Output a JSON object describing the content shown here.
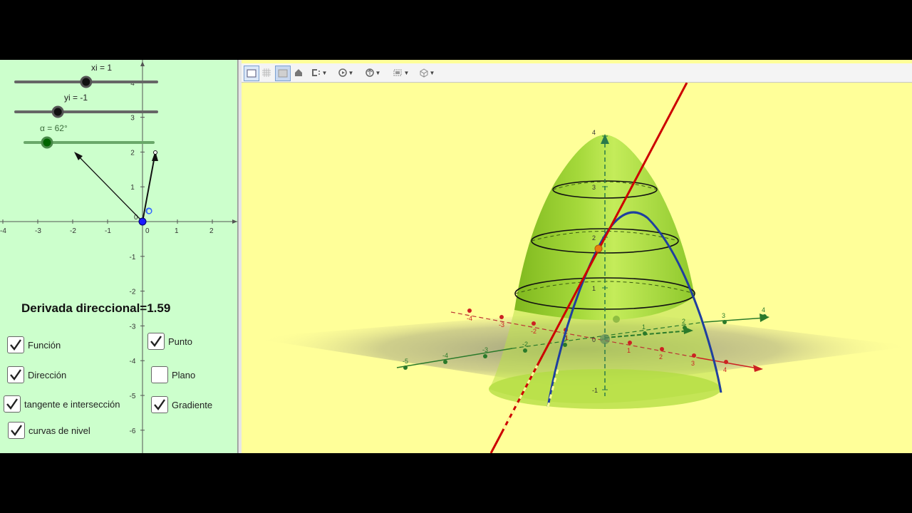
{
  "colors": {
    "left_bg": "#ccffcc",
    "right_bg": "#ffff99",
    "surface": "#9acd32",
    "red_line": "#cc0000",
    "blue_curve": "#1f3f9f"
  },
  "sliders": [
    {
      "label": "xi = 1",
      "value": 1,
      "min": -5,
      "max": 5
    },
    {
      "label": "yi = -1",
      "value": -1,
      "min": -5,
      "max": 5
    },
    {
      "label": "α = 62°",
      "value": 62,
      "min": 0,
      "max": 360
    }
  ],
  "derivative": {
    "text": "Derivada direccional=1.59"
  },
  "checkboxes": [
    {
      "label": "Función",
      "checked": true
    },
    {
      "label": "Dirección",
      "checked": true
    },
    {
      "label": "tangente e intersección",
      "checked": true
    },
    {
      "label": "curvas de nivel",
      "checked": true
    },
    {
      "label": "Punto",
      "checked": true
    },
    {
      "label": "Plano",
      "checked": false
    },
    {
      "label": "Gradiente",
      "checked": true
    }
  ],
  "graphics2d": {
    "x_ticks": [
      "-4",
      "-3",
      "-2",
      "-1",
      "0",
      "1",
      "2"
    ],
    "y_ticks": [
      "4",
      "3",
      "2",
      "1",
      "-1",
      "-2",
      "-3",
      "-4",
      "-5",
      "-6"
    ],
    "origin_label": "0",
    "point_label": "O"
  },
  "graphics3d": {
    "z_ticks": [
      "4",
      "3",
      "2",
      "1",
      "0",
      "-1"
    ],
    "red_axis_ticks": [
      "-4",
      "-3",
      "-2",
      "-1",
      "1",
      "2",
      "3",
      "4"
    ],
    "green_axis_ticks": [
      "-5",
      "-4",
      "-3",
      "-2",
      "-1",
      "1",
      "2",
      "3",
      "4"
    ]
  },
  "toolbar": {
    "icons": [
      "graphics-view-icon",
      "grid-icon",
      "axes-icon",
      "home-icon",
      "clipping-icon",
      "rotate-icon",
      "view-direction-icon",
      "projection-icon",
      "cube-icon"
    ]
  }
}
